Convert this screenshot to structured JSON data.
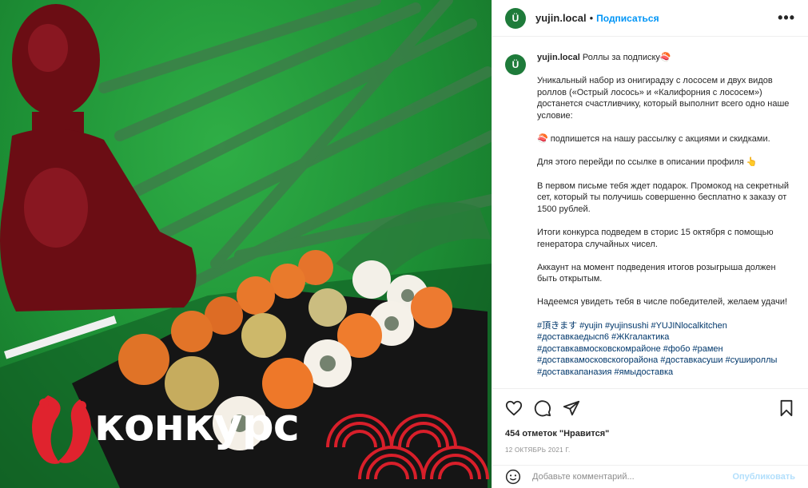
{
  "post": {
    "overlay_text": "конкурс",
    "avatar_letter": "Ü",
    "username": "yujin.local",
    "follow_label": "Подписаться",
    "separator": "•",
    "more_label": "•••",
    "caption": {
      "title": "Роллы за подписку🍣",
      "p1": "Уникальный набор из онигирадзу с лососем и двух видов роллов («Острый лосось» и «Калифорния с лососем») достанется счастливчику, который выполнит всего одно наше условие:",
      "p2": "🍣 подпишется на нашу рассылку с акциями и скидками.",
      "p3": "Для этого перейди по ссылке в описании профиля 👆",
      "p4": "В первом письме тебя ждет подарок. Промокод на секретный сет, который ты получишь совершенно бесплатно к заказу от 1500 рублей.",
      "p5": "Итоги конкурса подведем в сторис 15 октября с помощью генератора случайных чисел.",
      "p6": "Аккаунт на момент подведения итогов розыгрыша должен быть открытым.",
      "p7": "Надеемся увидеть тебя в числе победителей, желаем удачи!",
      "tags": "#頂きます #yujin #yujinsushi #YUJINlocalkitchen #доставкаедысп6 #ЖКгалактика #доставкавмосковскомрайоне #фобо #рамен #доставкамосковскогорайона #доставкасуши #сушироллы #доставкапаназия #ямыдоставка",
      "ellipsis": "..."
    },
    "likes_text": "454 отметок \"Нравится\"",
    "date_text": "12 октябрь 2021 г.",
    "comment_placeholder": "Добавьте комментарий...",
    "post_button": "Опубликовать"
  },
  "colors": {
    "accent": "#0095f6",
    "avatar_bg": "#1e7b3a",
    "photo_green": "#1d8f35",
    "hashtag": "#00376b"
  },
  "icons": [
    "heart-icon",
    "comment-icon",
    "share-icon",
    "bookmark-icon",
    "emoji-icon",
    "more-icon"
  ]
}
